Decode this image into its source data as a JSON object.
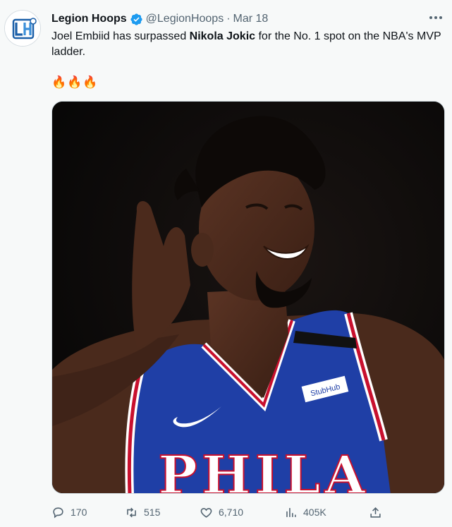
{
  "author": {
    "name": "Legion Hoops",
    "handle": "@LegionHoops",
    "separator": "·",
    "date": "Mar 18",
    "avatar_text": "LH",
    "verified_icon": "verified-badge-icon"
  },
  "tweet": {
    "text_before": "Joel Embiid has surpassed ",
    "text_bold": "Nikola Jokic",
    "text_after": " for the No. 1 spot on the NBA's MVP ladder.",
    "emoji": "🔥🔥🔥"
  },
  "media": {
    "jersey_text": "PHILA",
    "sponsor_patch": "StubHub"
  },
  "actions": {
    "reply_count": "170",
    "retweet_count": "515",
    "like_count": "6,710",
    "views_count": "405K"
  },
  "colors": {
    "accent": "#1d9bf0",
    "muted_text": "#536471",
    "jersey_blue": "#1f3fa6",
    "jersey_red": "#c8102e"
  }
}
